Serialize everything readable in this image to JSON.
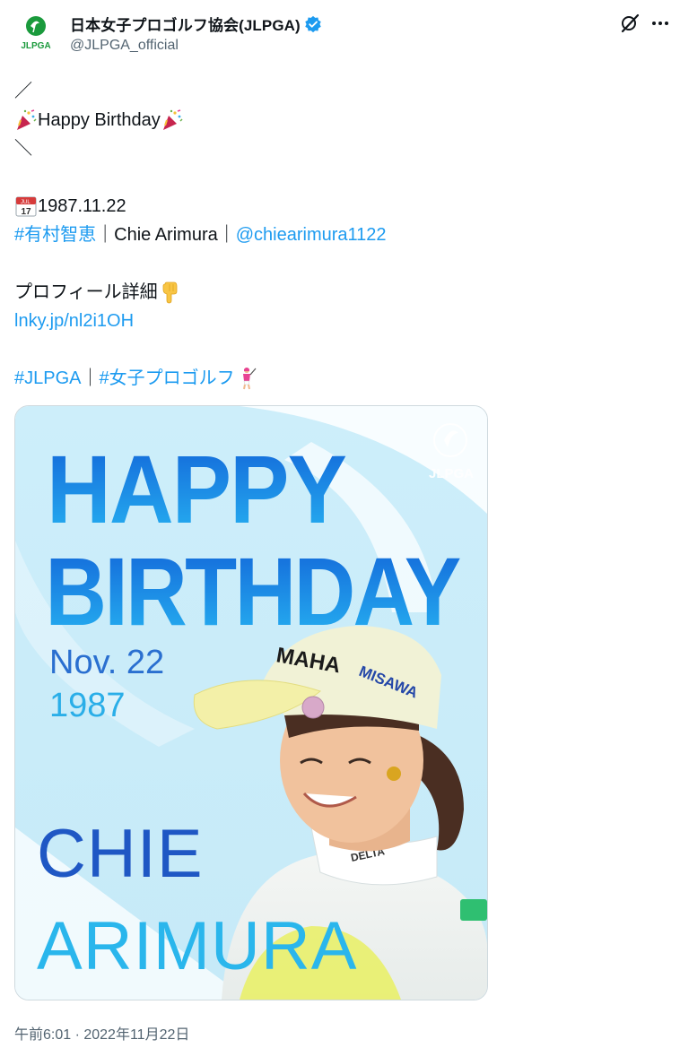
{
  "header": {
    "display_name": "日本女子プロゴルフ協会(JLPGA)",
    "handle": "@JLPGA_official",
    "avatar_text": "JLPGA"
  },
  "tweet": {
    "slash_top": "／",
    "birthday_text": "Happy Birthday",
    "slash_bottom": "＼",
    "date": "1987.11.22",
    "calendar_month": "JUL",
    "calendar_day": "17",
    "hashtag_name": "#有村智恵",
    "separator": "｜",
    "name_en": "Chie Arimura",
    "mention": "@chiearimura1122",
    "profile_label": "プロフィール詳細",
    "profile_link": "lnky.jp/nl2i1OH",
    "hashtag_org": "#JLPGA",
    "hashtag_golf": "#女子プロゴルフ"
  },
  "media": {
    "line1": "HAPPY",
    "line2": "BIRTHDAY",
    "date_line": "Nov. 22",
    "year_line": "1987",
    "first_name": "CHIE",
    "last_name": "ARIMURA",
    "logo_text": "JLPGA",
    "cap_brand": "MAHA",
    "cap_side": "MISAWA",
    "collar_brand": "DELTA"
  },
  "footer": {
    "timestamp": "午前6:01 · 2022年11月22日"
  },
  "colors": {
    "link": "#1d9bf0",
    "muted": "#536471",
    "verified": "#1d9bf0",
    "jlpga_green": "#1a9a3c",
    "banner_blue": "#1f8fe0"
  }
}
